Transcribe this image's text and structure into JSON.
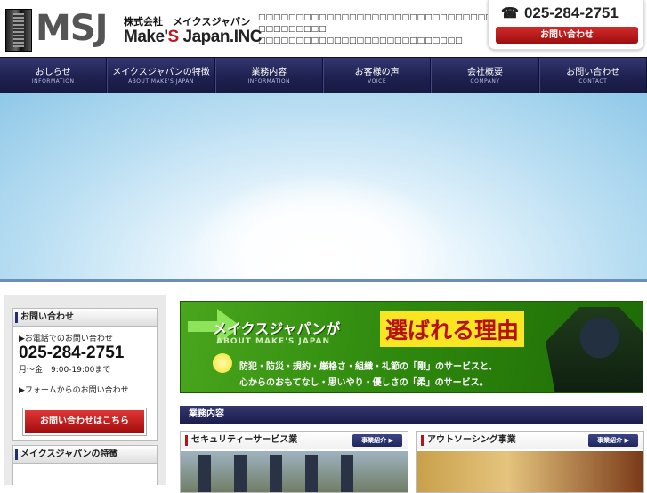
{
  "header": {
    "logo_mark": "MSJ",
    "company_ja": "株式会社　メイクスジャパン",
    "company_en_1": "Make'",
    "company_en_s": "S",
    "company_en_2": " Japan.INC",
    "intro_lines": [
      "□□□□□□□□□□□□□□□□□□□□□□□□□□□□□□□□□□□□□□□□□□□",
      "□□□□□□□□□",
      "□□□□□□□□□□□□□□□□□□□□□□□□□□□"
    ]
  },
  "tel_box": {
    "phone_icon": "phone-icon",
    "phone": "025-284-2751",
    "contact_label": "お問い合わせ"
  },
  "nav": [
    {
      "ja": "おしらせ",
      "en": "INFORMATION"
    },
    {
      "ja": "メイクスジャパンの特徴",
      "en": "ABOUT MAKE'S JAPAN"
    },
    {
      "ja": "業務内容",
      "en": "INFORMATION"
    },
    {
      "ja": "お客様の声",
      "en": "VOICE"
    },
    {
      "ja": "会社概要",
      "en": "COMPANY"
    },
    {
      "ja": "お問い合わせ",
      "en": "CONTACT"
    }
  ],
  "sidebar": {
    "contact_title": "お問い合わせ",
    "phone_label": "▶お電話でのお問い合わせ",
    "phone": "025-284-2751",
    "hours": "月～金　9:00-19:00まで",
    "form_label": "▶フォームからのお問い合わせ",
    "form_button": "お問い合わせはこちら",
    "feature_title": "メイクスジャパンの特徴"
  },
  "banner": {
    "title_1": "メイクスジャパンが",
    "title_2": "選ばれる理由",
    "en": "ABOUT MAKE'S JAPAN",
    "line_1": "防犯・防災・規約・厳格さ・組織・礼節の「剛」のサービスと、",
    "line_2": "心からのおもてなし・思いやり・優しさの「柔」のサービス。"
  },
  "services": {
    "title": "業務内容",
    "items": [
      {
        "title": "セキュリティーサービス業",
        "button": "事業紹介 ▶"
      },
      {
        "title": "アウトソーシング事業",
        "button": "事業紹介 ▶"
      }
    ]
  },
  "colors": {
    "nav_bg": "#1e2150",
    "accent_red": "#c0161e",
    "banner_green": "#2f8a0e",
    "banner_yellow": "#f9e521"
  }
}
